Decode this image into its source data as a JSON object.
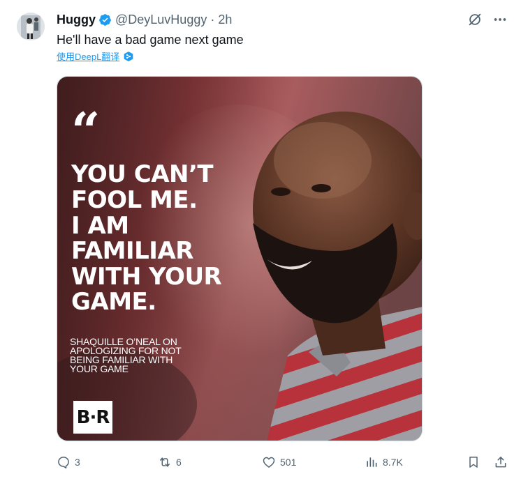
{
  "author": {
    "display_name": "Huggy",
    "handle": "@DeyLuvHuggy",
    "separator": "·",
    "time": "2h",
    "avatar_icon": "avatar-photo"
  },
  "tweet": {
    "text": "He'll have a bad game next game",
    "translate_label": "使用DeepL翻译",
    "translate_icon": "deepl-icon"
  },
  "media": {
    "quote_mark": "“",
    "quote_lines": [
      "YOU CAN’T",
      "FOOL ME.",
      "I AM",
      "FAMILIAR",
      "WITH YOUR",
      "GAME."
    ],
    "caption_lines": [
      "SHAQUILLE O’NEAL ON",
      "APOLOGIZING FOR NOT",
      "BEING FAMILIAR WITH",
      "YOUR GAME"
    ],
    "brand_logo": "B·R",
    "description_icon": "photo-of-man-with-beard-in-striped-polo"
  },
  "actions": {
    "replies": "3",
    "retweets": "6",
    "likes": "501",
    "views": "8.7K"
  },
  "colors": {
    "accent": "#1d9bf0",
    "text_primary": "#0f1419",
    "text_secondary": "#536471"
  }
}
